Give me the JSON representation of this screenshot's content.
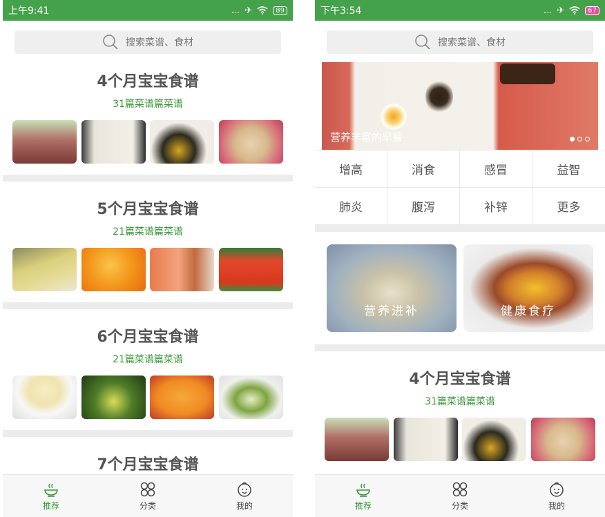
{
  "left": {
    "status": {
      "time": "上午9:41",
      "signal": "...",
      "battery": "89"
    },
    "search": {
      "placeholder": "搜索菜谱、食材"
    },
    "sections": [
      {
        "title": "4个月宝宝食谱",
        "subtitle": "31篇菜谱篇菜谱"
      },
      {
        "title": "5个月宝宝食谱",
        "subtitle": "21篇菜谱篇菜谱"
      },
      {
        "title": "6个月宝宝食谱",
        "subtitle": "21篇菜谱篇菜谱"
      },
      {
        "title": "7个月宝宝食谱",
        "subtitle": ""
      }
    ],
    "tabs": [
      {
        "label": "推荐",
        "icon": "bowl-icon"
      },
      {
        "label": "分类",
        "icon": "grid-icon"
      },
      {
        "label": "我的",
        "icon": "baby-face-icon"
      }
    ]
  },
  "right": {
    "status": {
      "time": "下午3:54",
      "signal": "...",
      "battery": "67"
    },
    "search": {
      "placeholder": "搜索菜谱、食材"
    },
    "banner": {
      "caption": "营养丰富的早餐"
    },
    "categories": [
      "增高",
      "消食",
      "感冒",
      "益智",
      "肺炎",
      "腹泻",
      "补锌",
      "更多"
    ],
    "cards": [
      {
        "label": "营养进补"
      },
      {
        "label": "健康食疗"
      }
    ],
    "section": {
      "title": "4个月宝宝食谱",
      "subtitle": "31篇菜谱篇菜谱"
    },
    "tabs": [
      {
        "label": "推荐",
        "icon": "bowl-icon"
      },
      {
        "label": "分类",
        "icon": "grid-icon"
      },
      {
        "label": "我的",
        "icon": "baby-face-icon"
      }
    ]
  },
  "colors": {
    "accent": "#44a24a",
    "subtitle": "#3a9a3a",
    "divider": "#ececec"
  }
}
